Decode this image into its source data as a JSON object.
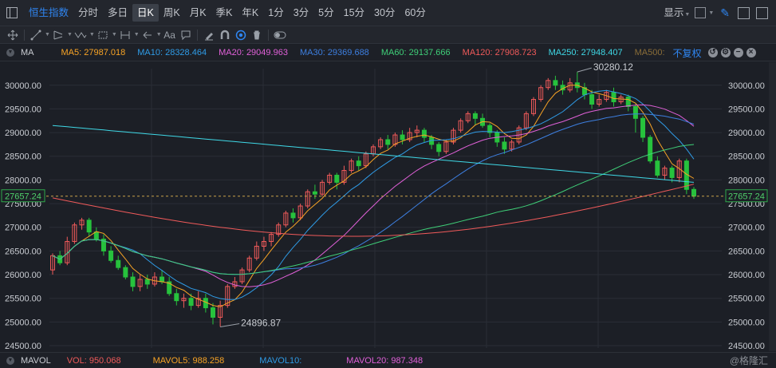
{
  "topbar": {
    "index_name": "恒生指数",
    "periods": [
      "分时",
      "多日",
      "日K",
      "周K",
      "月K",
      "季K",
      "年K",
      "1分",
      "3分",
      "5分",
      "15分",
      "30分",
      "60分"
    ],
    "active_period": "日K",
    "display_label": "显示"
  },
  "mabar": {
    "label": "MA",
    "items": [
      {
        "text": "MA5: 27987.018",
        "color": "#f7a325"
      },
      {
        "text": "MA10: 28328.464",
        "color": "#2f9be6"
      },
      {
        "text": "MA20: 29049.963",
        "color": "#e060d8"
      },
      {
        "text": "MA30: 29369.688",
        "color": "#3d7fe0"
      },
      {
        "text": "MA60: 29137.666",
        "color": "#3fcf78"
      },
      {
        "text": "MA120: 27908.723",
        "color": "#f05a5a"
      },
      {
        "text": "MA250: 27948.407",
        "color": "#3fd8e6"
      },
      {
        "text": "MA500:",
        "color": "#8a6d38"
      }
    ],
    "restore_label": "不复权"
  },
  "volbar": {
    "label": "MAVOL",
    "items": [
      {
        "text": "VOL: 950.068",
        "color": "#f05a5a"
      },
      {
        "text": "MAVOL5: 988.258",
        "color": "#f7a325"
      },
      {
        "text": "MAVOL10:",
        "color": "#2f9be6"
      },
      {
        "text": "MAVOL20: 987.348",
        "color": "#e060d8"
      }
    ],
    "watermark": "@格隆汇"
  },
  "colors": {
    "up": "#f05a5a",
    "down": "#27c23d",
    "bg": "#1c1f26",
    "grid": "#2a2e36",
    "axis_text": "#c9ccd2"
  },
  "chart_data": {
    "type": "candlestick",
    "y_ticks": [
      "30000.00",
      "29500.00",
      "29000.00",
      "28500.00",
      "28000.00",
      "27500.00",
      "27000.00",
      "26500.00",
      "26000.00",
      "25500.00",
      "25000.00",
      "24500.00"
    ],
    "ylim": [
      24450,
      30350
    ],
    "current_price": "27657.24",
    "high_label": "30280.12",
    "low_label": "24896.87",
    "candles": [
      [
        26100,
        26400,
        26000,
        26450
      ],
      [
        26400,
        26250,
        26200,
        26500
      ],
      [
        26250,
        26700,
        26200,
        26800
      ],
      [
        26700,
        27050,
        26650,
        27100
      ],
      [
        27050,
        27150,
        26950,
        27200
      ],
      [
        27150,
        26900,
        26800,
        27200
      ],
      [
        26900,
        26750,
        26700,
        27000
      ],
      [
        26750,
        26500,
        26400,
        26850
      ],
      [
        26500,
        26300,
        26250,
        26600
      ],
      [
        26300,
        26150,
        26100,
        26400
      ],
      [
        26150,
        25950,
        25900,
        26200
      ],
      [
        25950,
        25750,
        25650,
        26050
      ],
      [
        25750,
        25900,
        25650,
        26000
      ],
      [
        25900,
        25800,
        25700,
        26000
      ],
      [
        25800,
        25950,
        25750,
        26050
      ],
      [
        25950,
        25850,
        25800,
        26100
      ],
      [
        25850,
        25600,
        25550,
        25950
      ],
      [
        25600,
        25450,
        25350,
        25700
      ],
      [
        25450,
        25500,
        25300,
        25600
      ],
      [
        25500,
        25350,
        25250,
        25600
      ],
      [
        25350,
        25500,
        25300,
        25650
      ],
      [
        25500,
        25300,
        25200,
        25600
      ],
      [
        25300,
        25100,
        24950,
        25400
      ],
      [
        25100,
        25350,
        24900,
        25450
      ],
      [
        25350,
        25750,
        25300,
        25800
      ],
      [
        25750,
        25850,
        25700,
        25950
      ],
      [
        25850,
        26100,
        25800,
        26150
      ],
      [
        26100,
        26350,
        26050,
        26400
      ],
      [
        26350,
        26600,
        26300,
        26700
      ],
      [
        26600,
        26700,
        26500,
        26800
      ],
      [
        26700,
        26850,
        26600,
        26900
      ],
      [
        26850,
        27050,
        26800,
        27100
      ],
      [
        27050,
        27300,
        27000,
        27350
      ],
      [
        27300,
        27200,
        27100,
        27400
      ],
      [
        27200,
        27450,
        27150,
        27500
      ],
      [
        27450,
        27750,
        27400,
        27800
      ],
      [
        27750,
        27700,
        27600,
        27900
      ],
      [
        27700,
        27950,
        27650,
        28000
      ],
      [
        27950,
        28100,
        27900,
        28150
      ],
      [
        28100,
        27950,
        27800,
        28150
      ],
      [
        27950,
        28200,
        27900,
        28300
      ],
      [
        28200,
        28400,
        28150,
        28450
      ],
      [
        28400,
        28300,
        28200,
        28500
      ],
      [
        28300,
        28550,
        28250,
        28600
      ],
      [
        28550,
        28700,
        28500,
        28750
      ],
      [
        28700,
        28850,
        28650,
        28900
      ],
      [
        28850,
        28750,
        28650,
        28950
      ],
      [
        28750,
        28950,
        28700,
        29000
      ],
      [
        28950,
        28850,
        28750,
        29050
      ],
      [
        28850,
        29000,
        28800,
        29100
      ],
      [
        29000,
        29050,
        28900,
        29150
      ],
      [
        29050,
        28900,
        28800,
        29100
      ],
      [
        28900,
        28750,
        28650,
        28950
      ],
      [
        28750,
        28600,
        28500,
        28800
      ],
      [
        28600,
        28800,
        28550,
        28850
      ],
      [
        28800,
        29050,
        28750,
        29100
      ],
      [
        29050,
        29250,
        29000,
        29300
      ],
      [
        29250,
        29400,
        29200,
        29450
      ],
      [
        29400,
        29300,
        29150,
        29450
      ],
      [
        29300,
        29150,
        29100,
        29400
      ],
      [
        29150,
        29000,
        28900,
        29200
      ],
      [
        29000,
        28800,
        28700,
        29050
      ],
      [
        28800,
        28650,
        28550,
        28900
      ],
      [
        28650,
        28800,
        28600,
        28850
      ],
      [
        28800,
        29100,
        28750,
        29150
      ],
      [
        29100,
        29400,
        29050,
        29450
      ],
      [
        29400,
        29700,
        29350,
        29750
      ],
      [
        29700,
        29950,
        29650,
        30000
      ],
      [
        29950,
        30100,
        29900,
        30150
      ],
      [
        30100,
        30000,
        29900,
        30200
      ],
      [
        30000,
        29900,
        29800,
        30100
      ],
      [
        29900,
        30050,
        29850,
        30150
      ],
      [
        30050,
        29950,
        29850,
        30280
      ],
      [
        29950,
        29800,
        29700,
        30050
      ],
      [
        29800,
        29600,
        29500,
        29900
      ],
      [
        29600,
        29700,
        29550,
        29800
      ],
      [
        29700,
        29850,
        29650,
        29900
      ],
      [
        29850,
        29650,
        29550,
        29950
      ],
      [
        29650,
        29750,
        29600,
        29800
      ],
      [
        29750,
        29550,
        29450,
        29800
      ],
      [
        29550,
        29300,
        29000,
        29600
      ],
      [
        29300,
        28900,
        28800,
        29350
      ],
      [
        28900,
        28400,
        28350,
        28950
      ],
      [
        28400,
        28100,
        28050,
        28500
      ],
      [
        28100,
        28250,
        28000,
        28300
      ],
      [
        28250,
        28050,
        27950,
        28300
      ],
      [
        28050,
        28400,
        27950,
        28450
      ],
      [
        28400,
        27800,
        27700,
        28450
      ],
      [
        27800,
        27657.24,
        27600,
        27850
      ]
    ]
  }
}
